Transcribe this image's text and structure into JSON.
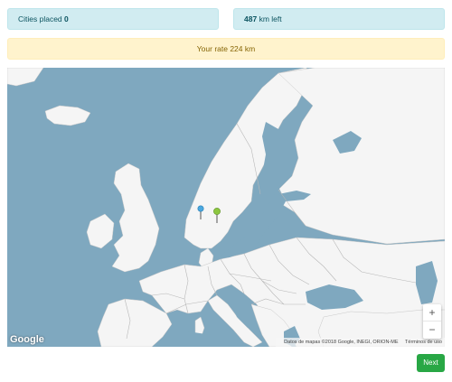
{
  "stats": {
    "cities_label": "Cities placed",
    "cities_value": "0",
    "km_value": "487",
    "km_label": "km left"
  },
  "rate": {
    "text": "Your rate 224 km"
  },
  "map": {
    "logo": "Google",
    "attribution": "Datos de mapas ©2018 Google, INEGI, ORION-ME",
    "terms": "Términos de uso",
    "zoom_in": "+",
    "zoom_out": "−",
    "pins": [
      {
        "name": "blue-map-pin",
        "color": "#4aa8e0"
      },
      {
        "name": "green-map-pin",
        "color": "#8cc63f"
      }
    ],
    "colors": {
      "water": "#7fa8bf",
      "land": "#f5f5f5",
      "border": "#b8b8b8"
    }
  },
  "next_button": {
    "label": "Next",
    "color": "#28a745"
  }
}
